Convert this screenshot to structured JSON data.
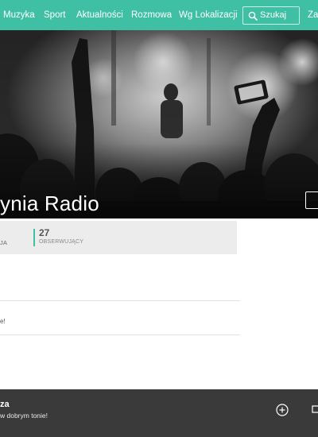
{
  "nav": {
    "items": [
      "Muzyka",
      "Sport",
      "Aktualności",
      "Rozmowa",
      "Wg Lokalizacji"
    ],
    "search_label": "Szukaj",
    "partial_item": "Zal"
  },
  "hero": {
    "title": "ynia Radio"
  },
  "stats": {
    "left_label": "JA",
    "followers_count": "27",
    "followers_label": "OBSERWUJĄCY"
  },
  "content": {
    "snippet": "e!"
  },
  "player": {
    "title": "za",
    "subtitle": "w dobrym tonie!"
  },
  "colors": {
    "accent": "#3fbfa3",
    "player_bg": "#3a3a3a",
    "stats_bg": "#ececec"
  }
}
